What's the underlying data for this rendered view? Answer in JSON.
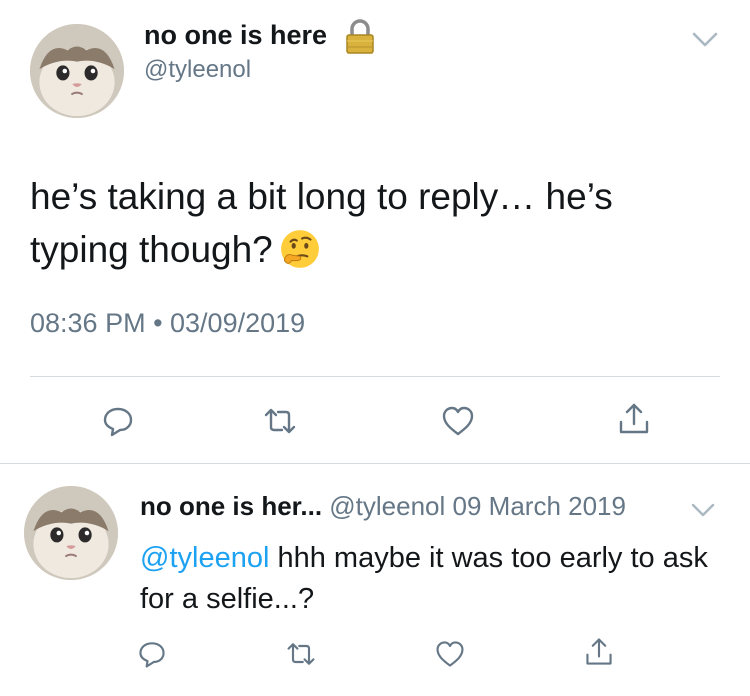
{
  "tweet": {
    "display_name": "no one is here",
    "handle": "@tyleenol",
    "text": "he’s taking a bit long to reply… he’s typing though?",
    "emoji": "thinking-face-emoji",
    "timestamp": "08:36 PM • 03/09/2019",
    "locked": true
  },
  "actions": [
    "reply-icon",
    "retweet-icon",
    "like-icon",
    "share-icon"
  ],
  "reply": {
    "display_name": "no one is her...",
    "handle": "@tyleenol",
    "date": "09 March 2019",
    "mention": "@tyleenol",
    "text": "hhh maybe it was too early to ask for a selfie...?"
  },
  "colors": {
    "text": "#14171a",
    "secondary": "#657786",
    "link": "#1da1f2",
    "divider": "#d6dbe0"
  }
}
